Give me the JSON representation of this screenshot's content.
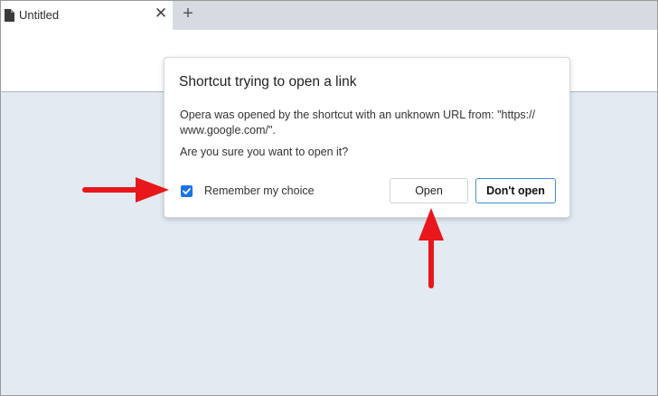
{
  "tab": {
    "title": "Untitled",
    "close_glyph": "✕",
    "new_tab_glyph": "+",
    "icon": "document-icon"
  },
  "dialog": {
    "title": "Shortcut trying to open a link",
    "message_line1": "Opera was opened by the shortcut with an unknown URL from: \"https://",
    "message_line2": "www.google.com/\".",
    "question": "Are you sure you want to open it?",
    "remember_label": "Remember my choice",
    "remember_checked": true,
    "open_label": "Open",
    "dont_open_label": "Don't open"
  },
  "annotations": {
    "arrow_color": "#e8171b",
    "arrows": [
      "arrow-to-checkbox",
      "arrow-to-open-button"
    ]
  },
  "colors": {
    "accent": "#1a73e8",
    "content_bg": "#e3eaf2",
    "tabstrip_bg": "#d6dbe2"
  }
}
